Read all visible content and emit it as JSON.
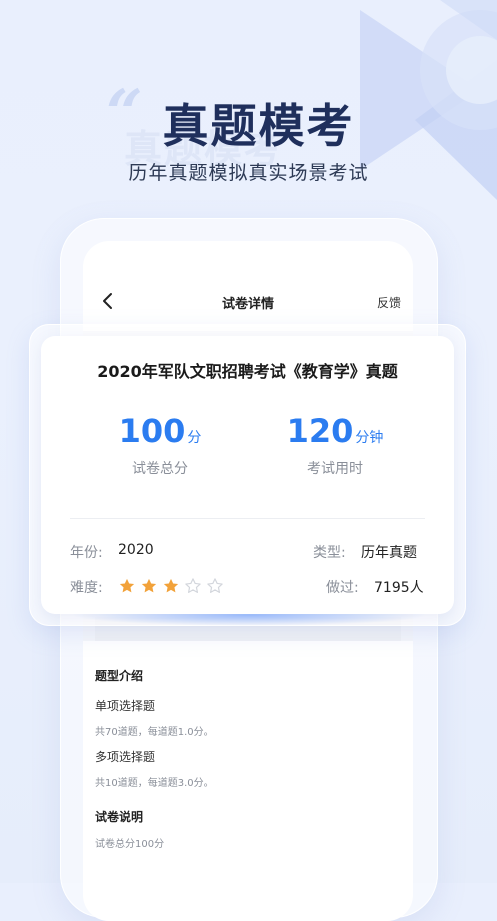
{
  "hero": {
    "title": "真题模考",
    "subtitle": "历年真题模拟真实场景考试"
  },
  "nav": {
    "title": "试卷详情",
    "feedback_label": "反馈"
  },
  "card": {
    "title": "2020年军队文职招聘考试《教育学》真题",
    "score": {
      "value": "100",
      "unit": "分",
      "label": "试卷总分"
    },
    "duration": {
      "value": "120",
      "unit": "分钟",
      "label": "考试用时"
    },
    "year_label": "年份:",
    "year_value": "2020",
    "type_label": "类型:",
    "type_value": "历年真题",
    "difficulty_label": "难度:",
    "difficulty_stars": 3,
    "difficulty_max": 5,
    "done_label": "做过:",
    "done_value": "7195人"
  },
  "intro": {
    "section_title": "题型介绍",
    "items": [
      {
        "title": "单项选择题",
        "desc": "共70道题，每道题1.0分。"
      },
      {
        "title": "多项选择题",
        "desc": "共10道题，每道题3.0分。"
      }
    ]
  },
  "notes": {
    "section_title": "试卷说明",
    "desc": "试卷总分100分"
  },
  "colors": {
    "accent": "#2b7cf0",
    "star_filled": "#f2a23a",
    "star_empty": "#d3d6dc",
    "hero_title": "#1f2f5c"
  }
}
